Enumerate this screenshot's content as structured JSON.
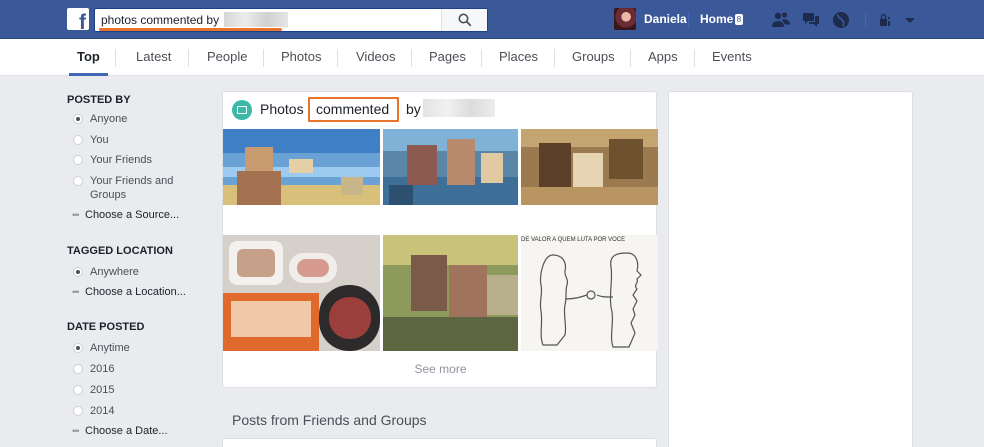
{
  "header": {
    "logo": "f",
    "search_value": "photos commented by",
    "profile_name": "Daniela",
    "home_label": "Home",
    "home_badge": "8"
  },
  "tabs": [
    "Top",
    "Latest",
    "People",
    "Photos",
    "Videos",
    "Pages",
    "Places",
    "Groups",
    "Apps",
    "Events"
  ],
  "filters": {
    "posted_by": {
      "heading": "POSTED BY",
      "options": [
        "Anyone",
        "You",
        "Your Friends",
        "Your Friends and",
        "Groups"
      ],
      "more": "Choose a Source..."
    },
    "tagged_location": {
      "heading": "TAGGED LOCATION",
      "options": [
        "Anywhere"
      ],
      "more": "Choose a Location..."
    },
    "date_posted": {
      "heading": "DATE POSTED",
      "options": [
        "Anytime",
        "2016",
        "2015",
        "2014"
      ],
      "more": "Choose a Date..."
    }
  },
  "results": {
    "title_prefix": "Photos",
    "title_highlight": "commented",
    "title_suffix": "by",
    "photo_caption": "DE VALOR A QUEM LUTA POR VOCE",
    "see_more": "See more"
  },
  "posts_heading": "Posts from Friends and Groups",
  "colors": {
    "brand_blue": "#3b5998",
    "highlight_orange": "#e8742c",
    "page_bg": "#e9ebee",
    "photos_icon": "#3cb8a9"
  }
}
